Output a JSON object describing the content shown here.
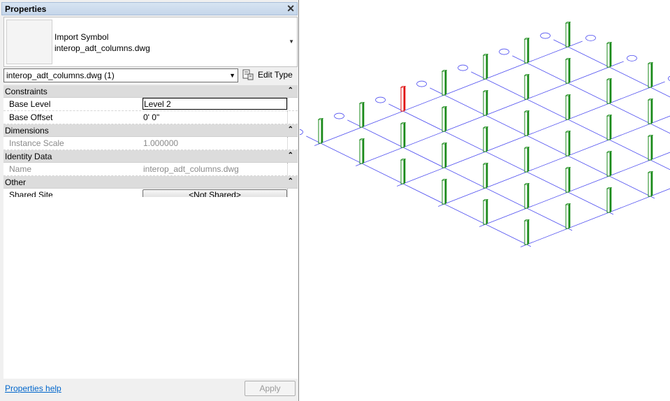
{
  "panel": {
    "title": "Properties",
    "close_glyph": "✕",
    "type_selector": {
      "family": "Import Symbol",
      "type": "interop_adt_columns.dwg"
    },
    "instance_filter": "interop_adt_columns.dwg (1)",
    "edit_type_label": "Edit Type",
    "groups": [
      {
        "name": "Constraints",
        "rows": [
          {
            "label": "Base Level",
            "value": "Level 2"
          },
          {
            "label": "Base Offset",
            "value": "0'  0\""
          }
        ]
      },
      {
        "name": "Dimensions",
        "rows": [
          {
            "label": "Instance Scale",
            "value": "1.000000"
          }
        ]
      },
      {
        "name": "Identity Data",
        "rows": [
          {
            "label": "Name",
            "value": "interop_adt_columns.dwg"
          }
        ]
      },
      {
        "name": "Other",
        "rows": [
          {
            "label": "Shared Site",
            "value": "<Not Shared>"
          }
        ]
      }
    ],
    "collapse_glyph": "⌃",
    "help_link": "Properties help",
    "apply_label": "Apply"
  },
  "colors": {
    "grid_line": "#4a4af0",
    "column": "#1a8a1a",
    "selected_column": "#e01010",
    "link": "#0066cc"
  }
}
